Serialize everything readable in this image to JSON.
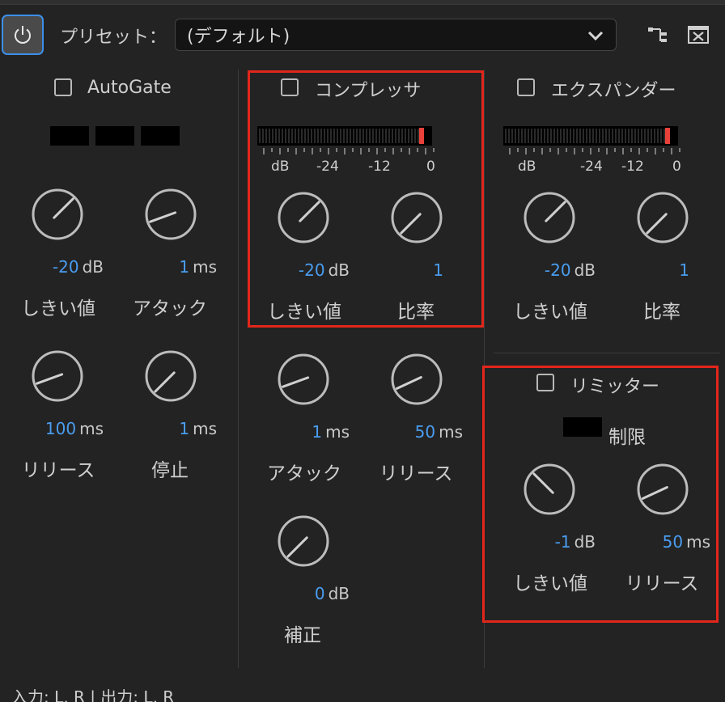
{
  "toolbar": {
    "preset_label": "プリセット：",
    "preset_value": "(デフォルト)"
  },
  "autogate": {
    "title": "AutoGate",
    "knobs": [
      {
        "value": "-20",
        "unit": "dB",
        "label": "しきい値"
      },
      {
        "value": "1",
        "unit": "ms",
        "label": "アタック"
      },
      {
        "value": "100",
        "unit": "ms",
        "label": "リリース"
      },
      {
        "value": "1",
        "unit": "ms",
        "label": "停止"
      }
    ]
  },
  "compressor": {
    "title": "コンプレッサ",
    "meter_ticks": [
      "dB",
      "-24",
      "-12",
      "0"
    ],
    "knobs": [
      {
        "value": "-20",
        "unit": "dB",
        "label": "しきい値"
      },
      {
        "value": "1",
        "unit": "",
        "label": "比率"
      },
      {
        "value": "1",
        "unit": "ms",
        "label": "アタック"
      },
      {
        "value": "50",
        "unit": "ms",
        "label": "リリース"
      },
      {
        "value": "0",
        "unit": "dB",
        "label": "補正"
      }
    ]
  },
  "expander": {
    "title": "エクスパンダー",
    "meter_ticks": [
      "dB",
      "-24",
      "-12",
      "0"
    ],
    "knobs": [
      {
        "value": "-20",
        "unit": "dB",
        "label": "しきい値"
      },
      {
        "value": "1",
        "unit": "",
        "label": "比率"
      }
    ]
  },
  "limiter": {
    "title": "リミッター",
    "limit_label": "制限",
    "knobs": [
      {
        "value": "-1",
        "unit": "dB",
        "label": "しきい値"
      },
      {
        "value": "50",
        "unit": "ms",
        "label": "リリース"
      }
    ]
  },
  "status": {
    "text": "入力: L, R | 出力: L, R"
  },
  "colors": {
    "accent_blue": "#4a9df0",
    "highlight_red": "#e2261b",
    "meter_peak": "#e8413a"
  }
}
